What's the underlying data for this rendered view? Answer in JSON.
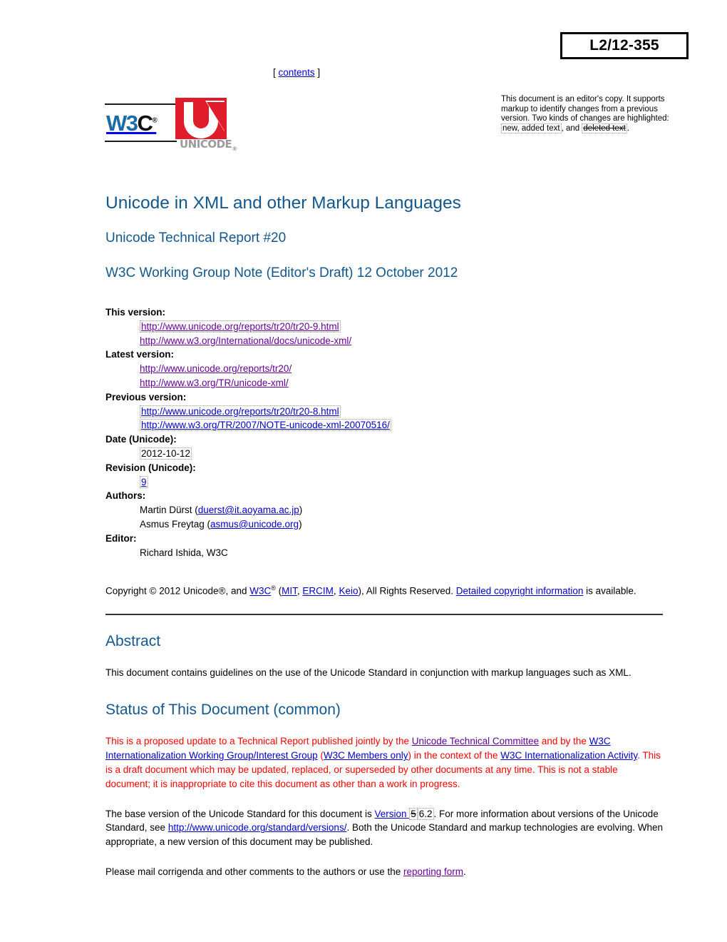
{
  "document_number": "L2/12-355",
  "contents_link": {
    "open_bracket": "[",
    "label": "contents",
    "close_bracket": "]"
  },
  "editor_note": {
    "text_before": "This document is an editor's copy. It supports markup to identify changes from a previous version. Two kinds of changes are highlighted: ",
    "added_example": "new, added text",
    "text_middle": ", and ",
    "deleted_example": "deleted text",
    "text_after": "."
  },
  "logos": {
    "w3c": {
      "name": "w3c-logo",
      "w_text": "W3",
      "c_text": "C",
      "registered": "®"
    },
    "unicode": {
      "name": "unicode-logo",
      "word": "UNICODE",
      "tm": "®"
    }
  },
  "title": "Unicode in XML and other Markup Languages",
  "subtitle1": "Unicode Technical Report #20",
  "subtitle2": "W3C Working Group Note (Editor's Draft) 12 October 2012",
  "version_info": [
    {
      "term": "This version:",
      "values": [
        {
          "text": "http://www.unicode.org/reports/tr20/tr20-9.html",
          "link": true,
          "state": "visited",
          "added": true
        },
        {
          "text": "http://www.w3.org/International/docs/unicode-xml/",
          "link": true,
          "state": "visited",
          "added": false
        }
      ]
    },
    {
      "term": "Latest version:",
      "values": [
        {
          "text": "http://www.unicode.org/reports/tr20/",
          "link": true,
          "state": "visited",
          "added": false
        },
        {
          "text": "http://www.w3.org/TR/unicode-xml/",
          "link": true,
          "state": "visited",
          "added": false
        }
      ]
    },
    {
      "term": "Previous version:",
      "values": [
        {
          "text": "http://www.unicode.org/reports/tr20/tr20-8.html",
          "link": true,
          "state": "unvisited",
          "added": true
        },
        {
          "text": "http://www.w3.org/TR/2007/NOTE-unicode-xml-20070516/",
          "link": true,
          "state": "unvisited",
          "added": true
        }
      ]
    },
    {
      "term": "Date (Unicode):",
      "values": [
        {
          "text": "2012-10-12",
          "link": false,
          "state": "none",
          "added": true
        }
      ]
    },
    {
      "term": "Revision (Unicode):",
      "values": [
        {
          "text": "9",
          "link": true,
          "state": "unvisited",
          "added": true
        }
      ]
    },
    {
      "term": "Authors:",
      "values": [
        {
          "text": "Martin Dürst (duerst@it.aoyama.ac.jp)",
          "link": false,
          "state": "none",
          "added": false,
          "parts": [
            {
              "t": "Martin Dürst (",
              "link": false
            },
            {
              "t": "duerst@it.aoyama.ac.jp",
              "link": true,
              "state": "unvisited"
            },
            {
              "t": ")",
              "link": false
            }
          ]
        },
        {
          "text": "Asmus Freytag (asmus@unicode.org)",
          "link": false,
          "state": "none",
          "added": false,
          "parts": [
            {
              "t": "Asmus Freytag (",
              "link": false
            },
            {
              "t": "asmus@unicode.org",
              "link": true,
              "state": "unvisited"
            },
            {
              "t": ")",
              "link": false
            }
          ]
        }
      ]
    },
    {
      "term": "Editor:",
      "values": [
        {
          "text": "Richard Ishida, W3C",
          "link": false,
          "state": "none",
          "added": false
        }
      ]
    }
  ],
  "copyright": {
    "part1": "Copyright © 2012 Unicode®, and ",
    "w3c_link": "W3C",
    "sup": "®",
    "open_paren": " (",
    "mit_link": "MIT",
    "sep1": ", ",
    "ercim_link": "ERCIM",
    "sep2": ", ",
    "keio_link": "Keio",
    "part2": "), All Rights Reserved. ",
    "detailed_link": "Detailed copyright information",
    "part3": " is available."
  },
  "abstract": {
    "heading": "Abstract",
    "text": "This document contains guidelines on the use of the Unicode Standard in conjunction with markup languages such as XML."
  },
  "status": {
    "heading": "Status of This Document (common)",
    "para1": {
      "s1": "This is a proposed update to a Technical Report published jointly by the ",
      "link1": "Unicode Technical Committee",
      "s2": " and by the ",
      "link2": "W3C Internationalization Working Group/Interest Group",
      "s3": " (",
      "link3": "W3C Members only",
      "s4": ") in the context of the ",
      "link4": "W3C Internationalization Activity",
      "s5": ". This is a draft document which may be updated, replaced, or superseded by other documents at any time. This is not a stable document; it is inappropriate to cite this document as other than a work in progress."
    },
    "para2": {
      "s1": "The base version of the Unicode Standard for this document is ",
      "link_version": "Version ",
      "deleted_version": "5",
      "added_version": "6.2",
      "s2": ". For more information about versions of the Unicode Standard, see ",
      "link_versions_url": "http://www.unicode.org/standard/versions/",
      "s3": ". Both the Unicode Standard and markup technologies are evolving. When appropriate, a new version of this document may be published."
    },
    "para3": {
      "s1": "Please mail corrigenda and other comments to the authors or use the ",
      "link": "reporting form",
      "s2": "."
    }
  },
  "colors": {
    "heading_blue": "#13578f",
    "link_blue": "#0000cc",
    "link_visited": "#660099",
    "status_red": "#ff0000",
    "unicode_red": "#e01b2a",
    "w3c_blue": "#1a6ba8",
    "unicode_gray": "#9b9b9b"
  }
}
